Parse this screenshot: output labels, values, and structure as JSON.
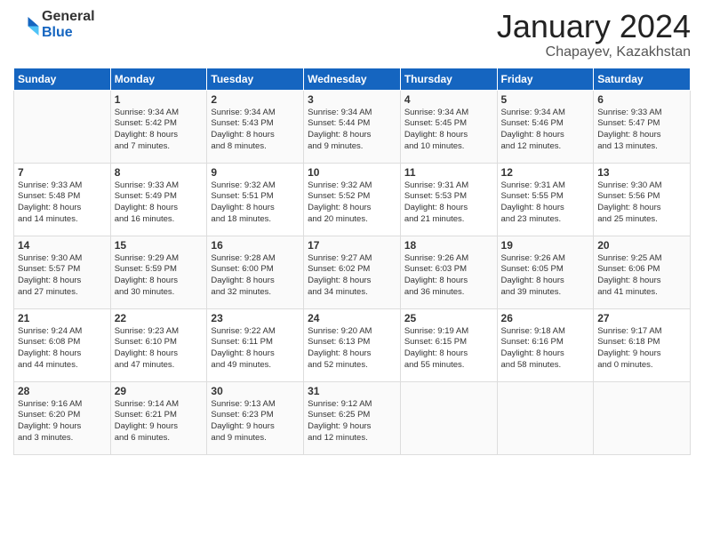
{
  "logo": {
    "general": "General",
    "blue": "Blue"
  },
  "header": {
    "title": "January 2024",
    "subtitle": "Chapayev, Kazakhstan"
  },
  "days_of_week": [
    "Sunday",
    "Monday",
    "Tuesday",
    "Wednesday",
    "Thursday",
    "Friday",
    "Saturday"
  ],
  "weeks": [
    {
      "days": [
        {
          "num": "",
          "info": ""
        },
        {
          "num": "1",
          "info": "Sunrise: 9:34 AM\nSunset: 5:42 PM\nDaylight: 8 hours\nand 7 minutes."
        },
        {
          "num": "2",
          "info": "Sunrise: 9:34 AM\nSunset: 5:43 PM\nDaylight: 8 hours\nand 8 minutes."
        },
        {
          "num": "3",
          "info": "Sunrise: 9:34 AM\nSunset: 5:44 PM\nDaylight: 8 hours\nand 9 minutes."
        },
        {
          "num": "4",
          "info": "Sunrise: 9:34 AM\nSunset: 5:45 PM\nDaylight: 8 hours\nand 10 minutes."
        },
        {
          "num": "5",
          "info": "Sunrise: 9:34 AM\nSunset: 5:46 PM\nDaylight: 8 hours\nand 12 minutes."
        },
        {
          "num": "6",
          "info": "Sunrise: 9:33 AM\nSunset: 5:47 PM\nDaylight: 8 hours\nand 13 minutes."
        }
      ]
    },
    {
      "days": [
        {
          "num": "7",
          "info": "Sunrise: 9:33 AM\nSunset: 5:48 PM\nDaylight: 8 hours\nand 14 minutes."
        },
        {
          "num": "8",
          "info": "Sunrise: 9:33 AM\nSunset: 5:49 PM\nDaylight: 8 hours\nand 16 minutes."
        },
        {
          "num": "9",
          "info": "Sunrise: 9:32 AM\nSunset: 5:51 PM\nDaylight: 8 hours\nand 18 minutes."
        },
        {
          "num": "10",
          "info": "Sunrise: 9:32 AM\nSunset: 5:52 PM\nDaylight: 8 hours\nand 20 minutes."
        },
        {
          "num": "11",
          "info": "Sunrise: 9:31 AM\nSunset: 5:53 PM\nDaylight: 8 hours\nand 21 minutes."
        },
        {
          "num": "12",
          "info": "Sunrise: 9:31 AM\nSunset: 5:55 PM\nDaylight: 8 hours\nand 23 minutes."
        },
        {
          "num": "13",
          "info": "Sunrise: 9:30 AM\nSunset: 5:56 PM\nDaylight: 8 hours\nand 25 minutes."
        }
      ]
    },
    {
      "days": [
        {
          "num": "14",
          "info": "Sunrise: 9:30 AM\nSunset: 5:57 PM\nDaylight: 8 hours\nand 27 minutes."
        },
        {
          "num": "15",
          "info": "Sunrise: 9:29 AM\nSunset: 5:59 PM\nDaylight: 8 hours\nand 30 minutes."
        },
        {
          "num": "16",
          "info": "Sunrise: 9:28 AM\nSunset: 6:00 PM\nDaylight: 8 hours\nand 32 minutes."
        },
        {
          "num": "17",
          "info": "Sunrise: 9:27 AM\nSunset: 6:02 PM\nDaylight: 8 hours\nand 34 minutes."
        },
        {
          "num": "18",
          "info": "Sunrise: 9:26 AM\nSunset: 6:03 PM\nDaylight: 8 hours\nand 36 minutes."
        },
        {
          "num": "19",
          "info": "Sunrise: 9:26 AM\nSunset: 6:05 PM\nDaylight: 8 hours\nand 39 minutes."
        },
        {
          "num": "20",
          "info": "Sunrise: 9:25 AM\nSunset: 6:06 PM\nDaylight: 8 hours\nand 41 minutes."
        }
      ]
    },
    {
      "days": [
        {
          "num": "21",
          "info": "Sunrise: 9:24 AM\nSunset: 6:08 PM\nDaylight: 8 hours\nand 44 minutes."
        },
        {
          "num": "22",
          "info": "Sunrise: 9:23 AM\nSunset: 6:10 PM\nDaylight: 8 hours\nand 47 minutes."
        },
        {
          "num": "23",
          "info": "Sunrise: 9:22 AM\nSunset: 6:11 PM\nDaylight: 8 hours\nand 49 minutes."
        },
        {
          "num": "24",
          "info": "Sunrise: 9:20 AM\nSunset: 6:13 PM\nDaylight: 8 hours\nand 52 minutes."
        },
        {
          "num": "25",
          "info": "Sunrise: 9:19 AM\nSunset: 6:15 PM\nDaylight: 8 hours\nand 55 minutes."
        },
        {
          "num": "26",
          "info": "Sunrise: 9:18 AM\nSunset: 6:16 PM\nDaylight: 8 hours\nand 58 minutes."
        },
        {
          "num": "27",
          "info": "Sunrise: 9:17 AM\nSunset: 6:18 PM\nDaylight: 9 hours\nand 0 minutes."
        }
      ]
    },
    {
      "days": [
        {
          "num": "28",
          "info": "Sunrise: 9:16 AM\nSunset: 6:20 PM\nDaylight: 9 hours\nand 3 minutes."
        },
        {
          "num": "29",
          "info": "Sunrise: 9:14 AM\nSunset: 6:21 PM\nDaylight: 9 hours\nand 6 minutes."
        },
        {
          "num": "30",
          "info": "Sunrise: 9:13 AM\nSunset: 6:23 PM\nDaylight: 9 hours\nand 9 minutes."
        },
        {
          "num": "31",
          "info": "Sunrise: 9:12 AM\nSunset: 6:25 PM\nDaylight: 9 hours\nand 12 minutes."
        },
        {
          "num": "",
          "info": ""
        },
        {
          "num": "",
          "info": ""
        },
        {
          "num": "",
          "info": ""
        }
      ]
    }
  ]
}
